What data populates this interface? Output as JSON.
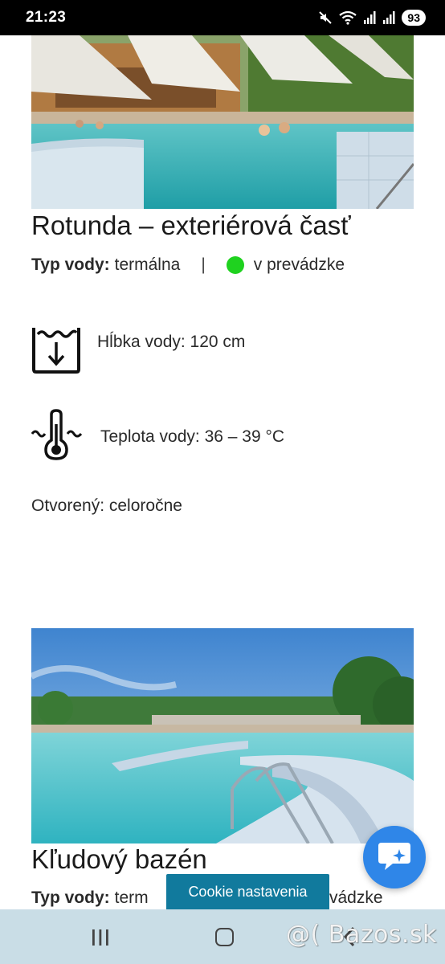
{
  "status_bar": {
    "time": "21:23",
    "battery": "93",
    "icons": [
      "mute-icon",
      "wifi-icon",
      "signal-icon",
      "signal-icon"
    ]
  },
  "pools": [
    {
      "title": "Rotunda – exteriérová časť",
      "type_label": "Typ vody:",
      "type_value": "termálna",
      "separator": "|",
      "status": "v prevádzke",
      "status_color": "#1fd21f",
      "depth": "Hĺbka vody: 120 cm",
      "temperature": "Teplota vody: 36 – 39 °C",
      "open": "Otvorený: celoročne"
    },
    {
      "title": "Kľudový bazén",
      "type_label": "Typ vody:",
      "type_value": "term",
      "status": "vádzke"
    }
  ],
  "chat_button": {
    "color": "#2f86e8",
    "icon": "chat-sparkle-icon"
  },
  "cookie": {
    "label": "Cookie nastavenia",
    "color": "#117a9d"
  },
  "nav_bar": {
    "icons": [
      "recents-icon",
      "home-icon",
      "back-icon"
    ]
  },
  "watermark": "@( Bazos.sk"
}
